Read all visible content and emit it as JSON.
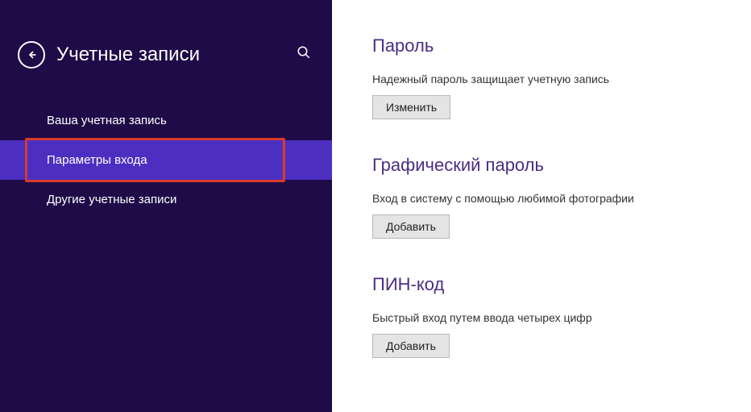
{
  "sidebar": {
    "title": "Учетные записи",
    "items": [
      {
        "label": "Ваша учетная запись"
      },
      {
        "label": "Параметры входа"
      },
      {
        "label": "Другие учетные записи"
      }
    ],
    "active_index": 1
  },
  "main": {
    "sections": [
      {
        "title": "Пароль",
        "description": "Надежный пароль защищает учетную запись",
        "button": "Изменить"
      },
      {
        "title": "Графический пароль",
        "description": "Вход в систему с помощью любимой фотографии",
        "button": "Добавить"
      },
      {
        "title": "ПИН-код",
        "description": "Быстрый вход путем ввода четырех цифр",
        "button": "Добавить"
      }
    ]
  }
}
